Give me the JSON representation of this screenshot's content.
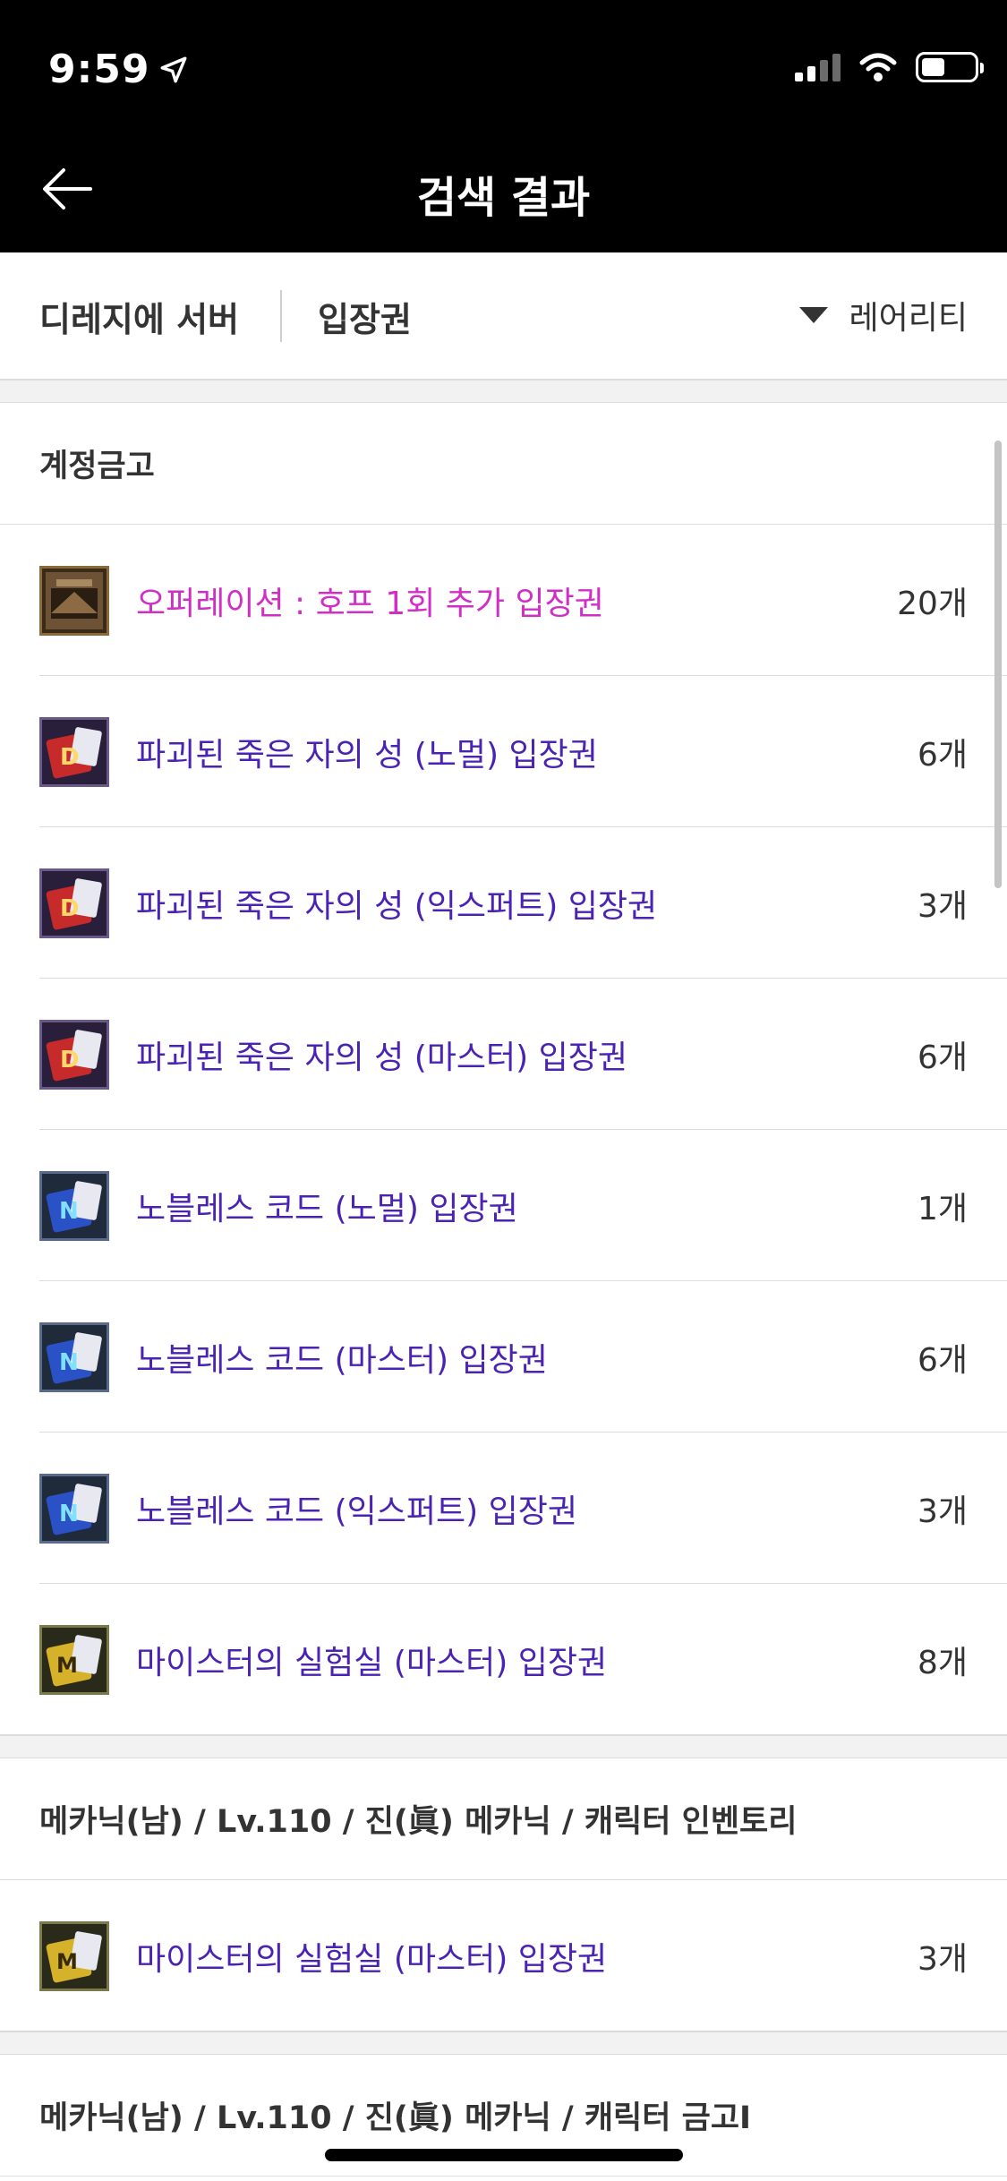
{
  "status_bar": {
    "time": "9:59"
  },
  "header": {
    "title": "검색 결과"
  },
  "filter": {
    "server": "디레지에 서버",
    "keyword": "입장권",
    "sort_label": "레어리티"
  },
  "sections": [
    {
      "title": "계정금고",
      "items": [
        {
          "name": "오퍼레이션 : 호프 1회 추가 입장권",
          "count": "20개",
          "icon": "hope-ticket-icon",
          "color": "#d02fc6"
        },
        {
          "name": "파괴된 죽은 자의 성 (노멀) 입장권",
          "count": "6개",
          "icon": "d-ticket-icon",
          "color": "#4a23b3"
        },
        {
          "name": "파괴된 죽은 자의 성 (익스퍼트) 입장권",
          "count": "3개",
          "icon": "d-ticket-icon",
          "color": "#4a23b3"
        },
        {
          "name": "파괴된 죽은 자의 성 (마스터) 입장권",
          "count": "6개",
          "icon": "d-ticket-icon",
          "color": "#4a23b3"
        },
        {
          "name": "노블레스 코드 (노멀) 입장권",
          "count": "1개",
          "icon": "n-ticket-icon",
          "color": "#4a23b3"
        },
        {
          "name": "노블레스 코드 (마스터) 입장권",
          "count": "6개",
          "icon": "n-ticket-icon",
          "color": "#4a23b3"
        },
        {
          "name": "노블레스 코드 (익스퍼트) 입장권",
          "count": "3개",
          "icon": "n-ticket-icon",
          "color": "#4a23b3"
        },
        {
          "name": "마이스터의 실험실 (마스터) 입장권",
          "count": "8개",
          "icon": "m-ticket-icon",
          "color": "#4a23b3"
        }
      ]
    },
    {
      "title": "메카닉(남) / Lv.110 / 진(眞) 메카닉 / 캐릭터 인벤토리",
      "items": [
        {
          "name": "마이스터의 실험실 (마스터) 입장권",
          "count": "3개",
          "icon": "m-ticket-icon",
          "color": "#4a23b3"
        }
      ]
    },
    {
      "title": "메카닉(남) / Lv.110 / 진(眞) 메카닉 / 캐릭터 금고I",
      "items": []
    }
  ]
}
